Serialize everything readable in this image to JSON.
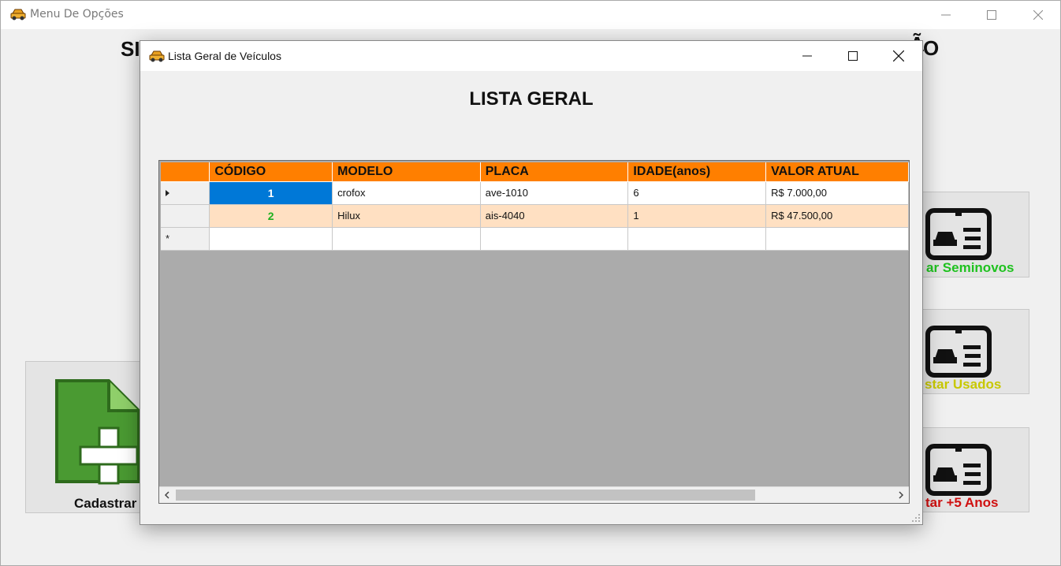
{
  "main_window": {
    "title": "Menu De Opções",
    "heading_left": "SI",
    "heading_right": "Ã",
    "tail_o": "O",
    "options": [
      {
        "label": "Cadastrar",
        "color": "#111111"
      },
      {
        "label": "ar Seminovos",
        "color": "#1fc21f"
      },
      {
        "label": "star Usados",
        "color": "#c8c800"
      },
      {
        "label": "tar +5 Anos",
        "color": "#d01010"
      }
    ]
  },
  "dialog": {
    "title": "Lista Geral de Veículos",
    "heading": "LISTA GERAL",
    "grid": {
      "columns": [
        "CÓDIGO",
        "MODELO",
        "PLACA",
        "IDADE(anos)",
        "VALOR ATUAL"
      ],
      "rows": [
        {
          "codigo": "1",
          "modelo": "crofox",
          "placa": "ave-1010",
          "idade": "6",
          "valor": "R$ 7.000,00"
        },
        {
          "codigo": "2",
          "modelo": "Hilux",
          "placa": "ais-4040",
          "idade": "1",
          "valor": "R$ 47.500,00"
        }
      ],
      "new_row_marker": "*",
      "header_color": "#ff7f00",
      "alt_row_color": "#ffe0c2",
      "selected_color": "#0078d7"
    }
  },
  "icons": {
    "app": "car-icon",
    "option_cards": "vehicle-card-icon",
    "add_document": "add-document-icon"
  }
}
